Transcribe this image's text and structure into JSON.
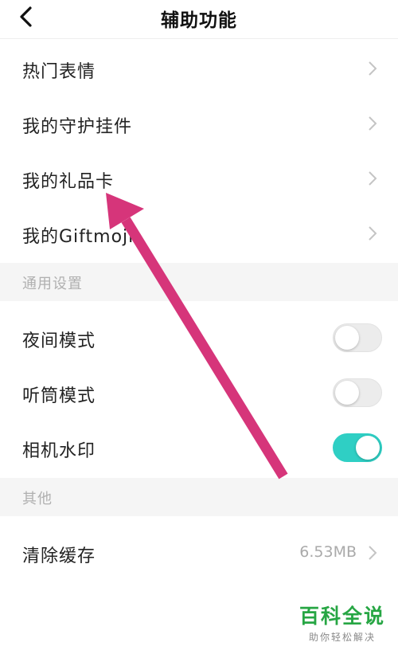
{
  "nav": {
    "title": "辅助功能"
  },
  "items_top": [
    {
      "label": "热门表情"
    },
    {
      "label": "我的守护挂件"
    },
    {
      "label": "我的礼品卡"
    },
    {
      "label": "我的Giftmoji"
    }
  ],
  "general": {
    "title": "通用设置",
    "toggles": [
      {
        "label": "夜间模式",
        "on": false
      },
      {
        "label": "听筒模式",
        "on": false
      },
      {
        "label": "相机水印",
        "on": true
      }
    ]
  },
  "other": {
    "title": "其他",
    "clear_cache": {
      "label": "清除缓存",
      "value": "6.53MB"
    }
  },
  "colors": {
    "toggle_on": "#2fcfc4",
    "annotation_arrow": "#d6357a",
    "watermark": "#27a644"
  },
  "watermark": {
    "title": "百科全说",
    "subtitle": "助你轻松解决"
  }
}
